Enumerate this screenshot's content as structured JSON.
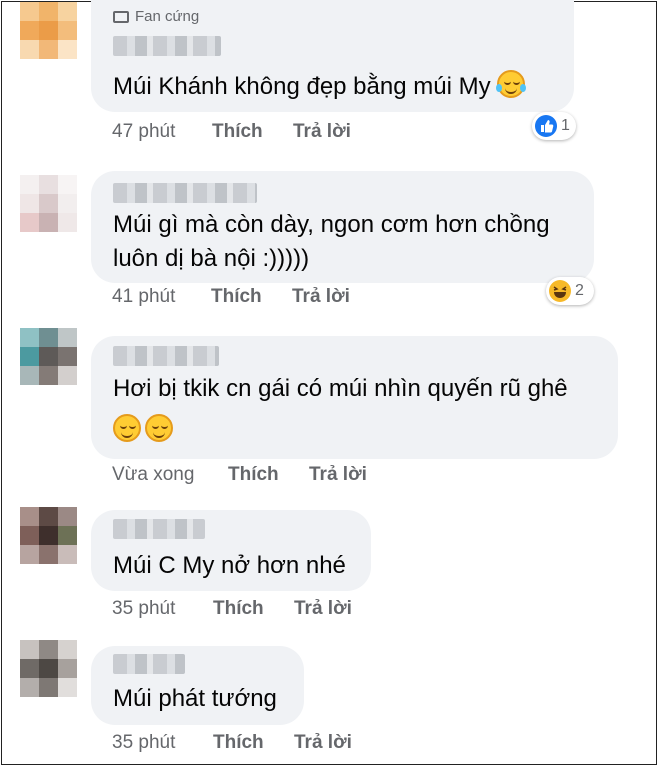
{
  "comments": [
    {
      "badge": "Fan cứng",
      "text_lines": [
        "Múi Khánh không đẹp bằng múi My"
      ],
      "time": "47 phút",
      "like": "Thích",
      "reply": "Trả lời",
      "reaction": {
        "type": "like-icon",
        "count": "1"
      }
    },
    {
      "text_lines": [
        "Múi gì mà còn dày, ngon cơm hơn chồng",
        "luôn dị bà nội :)))))"
      ],
      "time": "41 phút",
      "like": "Thích",
      "reply": "Trả lời",
      "reaction": {
        "type": "haha-icon",
        "count": "2"
      }
    },
    {
      "text_lines": [
        "Hơi bị tkik cn gái có múi nhìn quyến rũ ghê"
      ],
      "time": "Vừa xong",
      "like": "Thích",
      "reply": "Trả lời"
    },
    {
      "text_lines": [
        "Múi C My nở hơn nhé"
      ],
      "time": "35 phút",
      "like": "Thích",
      "reply": "Trả lời"
    },
    {
      "text_lines": [
        "Múi phát tướng"
      ],
      "time": "35 phút",
      "like": "Thích",
      "reply": "Trả lời"
    }
  ],
  "colors": {
    "bubble": "#f0f2f5",
    "meta": "#65676b",
    "like_blue": "#1877f2"
  }
}
